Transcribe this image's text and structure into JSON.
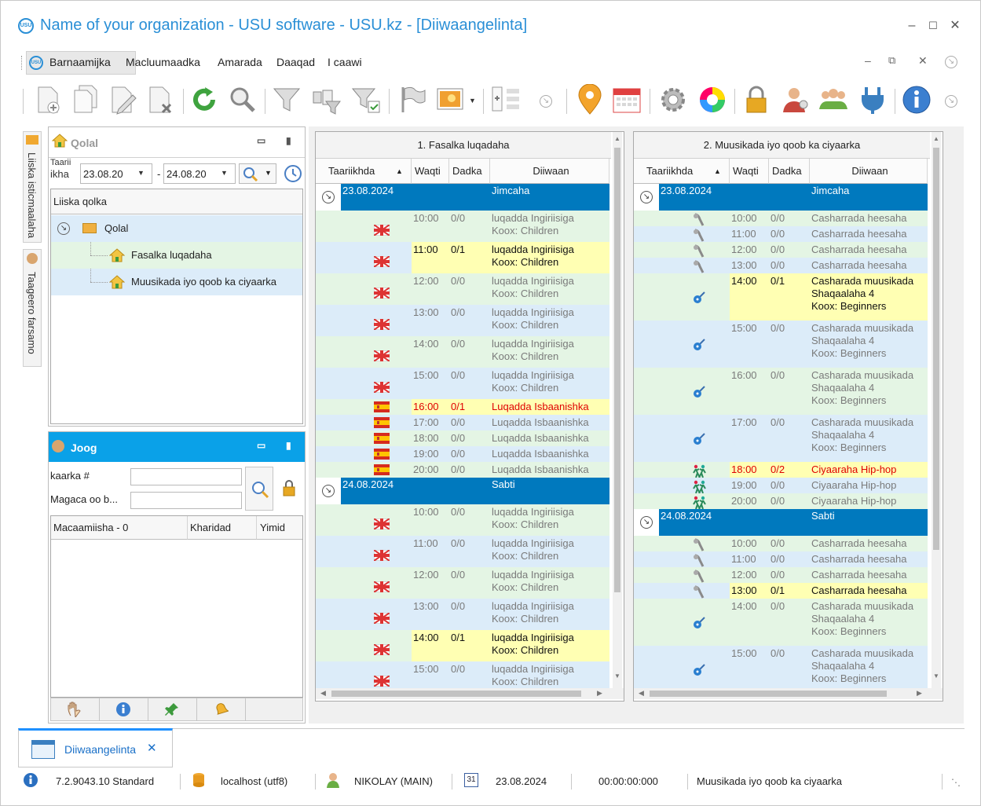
{
  "window": {
    "title": "Name of your organization - USU software - USU.kz - [Diiwaangelinta]",
    "logo_text": "USU"
  },
  "menu": {
    "items": [
      "Barnaamijka",
      "Macluumaadka",
      "Amarada",
      "Daaqad",
      "I caawi"
    ]
  },
  "toolbar": {
    "icons": [
      "add-icon",
      "copy-icon",
      "edit-icon",
      "delete-icon",
      "refresh-icon",
      "search-icon",
      "filter-icon",
      "filter-settings-icon",
      "filter-clear-icon",
      "flag-icon",
      "image-icon",
      "columns-icon",
      "location-pin-icon",
      "calendar-icon",
      "settings-gear-icon",
      "color-wheel-icon",
      "lock-icon",
      "user-admin-icon",
      "users-group-icon",
      "plug-icon",
      "info-icon"
    ]
  },
  "sidebar_tabs": [
    "Liiska isticmaalaha",
    "Taageero farsamo"
  ],
  "folders_panel": {
    "title": "Qolal",
    "date_label_top": "Taarii",
    "date_label": "ikha",
    "date_from": "23.08.20",
    "date_to": "24.08.20",
    "list_header": "Liiska qolka",
    "tree": [
      {
        "label": "Qolal",
        "level": 0
      },
      {
        "label": "Fasalka luqadaha",
        "level": 1
      },
      {
        "label": "Muusikada iyo qoob ka ciyaarka",
        "level": 1
      }
    ]
  },
  "booking_panel": {
    "title": "Joog",
    "card_label": "kaarka #",
    "name_label": "Magaca oo b...",
    "col_client": "Macaamiisha - 0",
    "col_expense": "Kharidad",
    "col_came": "Yimid"
  },
  "grid1": {
    "title": "1. Fasalka luqadaha",
    "columns": [
      "Taariikhda",
      "Waqti",
      "Dadka",
      "Diiwaan"
    ],
    "rows": [
      {
        "kind": "date",
        "date": "23.08.2024",
        "day": "Jimcaha"
      },
      {
        "kind": "row",
        "icon": "uk-flag-icon",
        "time": "10:00",
        "people": "0/0",
        "lines": [
          "luqadda Ingiriisiga",
          "Koox: Children"
        ],
        "bg": "green"
      },
      {
        "kind": "row",
        "icon": "uk-flag-icon",
        "time": "11:00",
        "people": "0/1",
        "lines": [
          "luqadda Ingiriisiga",
          "Koox: Children"
        ],
        "bg": "blue",
        "hl": true
      },
      {
        "kind": "row",
        "icon": "uk-flag-icon",
        "time": "12:00",
        "people": "0/0",
        "lines": [
          "luqadda Ingiriisiga",
          "Koox: Children"
        ],
        "bg": "green"
      },
      {
        "kind": "row",
        "icon": "uk-flag-icon",
        "time": "13:00",
        "people": "0/0",
        "lines": [
          "luqadda Ingiriisiga",
          "Koox: Children"
        ],
        "bg": "blue"
      },
      {
        "kind": "row",
        "icon": "uk-flag-icon",
        "time": "14:00",
        "people": "0/0",
        "lines": [
          "luqadda Ingiriisiga",
          "Koox: Children"
        ],
        "bg": "green"
      },
      {
        "kind": "row",
        "icon": "uk-flag-icon",
        "time": "15:00",
        "people": "0/0",
        "lines": [
          "luqadda Ingiriisiga",
          "Koox: Children"
        ],
        "bg": "blue"
      },
      {
        "kind": "row",
        "icon": "spain-flag-icon",
        "time": "16:00",
        "people": "0/1",
        "lines": [
          "Luqadda Isbaanishka"
        ],
        "bg": "green",
        "hl": true,
        "red": true
      },
      {
        "kind": "row",
        "icon": "spain-flag-icon",
        "time": "17:00",
        "people": "0/0",
        "lines": [
          "Luqadda Isbaanishka"
        ],
        "bg": "blue"
      },
      {
        "kind": "row",
        "icon": "spain-flag-icon",
        "time": "18:00",
        "people": "0/0",
        "lines": [
          "Luqadda Isbaanishka"
        ],
        "bg": "green"
      },
      {
        "kind": "row",
        "icon": "spain-flag-icon",
        "time": "19:00",
        "people": "0/0",
        "lines": [
          "Luqadda Isbaanishka"
        ],
        "bg": "blue"
      },
      {
        "kind": "row",
        "icon": "spain-flag-icon",
        "time": "20:00",
        "people": "0/0",
        "lines": [
          "Luqadda Isbaanishka"
        ],
        "bg": "green"
      },
      {
        "kind": "date",
        "date": "24.08.2024",
        "day": "Sabti"
      },
      {
        "kind": "row",
        "icon": "uk-flag-icon",
        "time": "10:00",
        "people": "0/0",
        "lines": [
          "luqadda Ingiriisiga",
          "Koox: Children"
        ],
        "bg": "green"
      },
      {
        "kind": "row",
        "icon": "uk-flag-icon",
        "time": "11:00",
        "people": "0/0",
        "lines": [
          "luqadda Ingiriisiga",
          "Koox: Children"
        ],
        "bg": "blue"
      },
      {
        "kind": "row",
        "icon": "uk-flag-icon",
        "time": "12:00",
        "people": "0/0",
        "lines": [
          "luqadda Ingiriisiga",
          "Koox: Children"
        ],
        "bg": "green"
      },
      {
        "kind": "row",
        "icon": "uk-flag-icon",
        "time": "13:00",
        "people": "0/0",
        "lines": [
          "luqadda Ingiriisiga",
          "Koox: Children"
        ],
        "bg": "blue"
      },
      {
        "kind": "row",
        "icon": "uk-flag-icon",
        "time": "14:00",
        "people": "0/1",
        "lines": [
          "luqadda Ingiriisiga",
          "Koox: Children"
        ],
        "bg": "green",
        "hl": true
      },
      {
        "kind": "row",
        "icon": "uk-flag-icon",
        "time": "15:00",
        "people": "0/0",
        "lines": [
          "luqadda Ingiriisiga",
          "Koox: Children"
        ],
        "bg": "blue"
      }
    ]
  },
  "grid2": {
    "title": "2. Muusikada iyo qoob ka ciyaarka",
    "columns": [
      "Taariikhda",
      "Waqti",
      "Dadka",
      "Diiwaan"
    ],
    "rows": [
      {
        "kind": "date",
        "date": "23.08.2024",
        "day": "Jimcaha"
      },
      {
        "kind": "row",
        "icon": "microphone-icon",
        "time": "10:00",
        "people": "0/0",
        "lines": [
          "Casharrada heesaha"
        ],
        "bg": "green"
      },
      {
        "kind": "row",
        "icon": "microphone-icon",
        "time": "11:00",
        "people": "0/0",
        "lines": [
          "Casharrada heesaha"
        ],
        "bg": "blue"
      },
      {
        "kind": "row",
        "icon": "microphone-icon",
        "time": "12:00",
        "people": "0/0",
        "lines": [
          "Casharrada heesaha"
        ],
        "bg": "green"
      },
      {
        "kind": "row",
        "icon": "microphone-icon",
        "time": "13:00",
        "people": "0/0",
        "lines": [
          "Casharrada heesaha"
        ],
        "bg": "blue"
      },
      {
        "kind": "row",
        "icon": "guitar-icon",
        "time": "14:00",
        "people": "0/1",
        "lines": [
          "Casharada muusikada",
          "Shaqaalaha 4",
          "Koox: Beginners"
        ],
        "bg": "green",
        "hl": true
      },
      {
        "kind": "row",
        "icon": "guitar-icon",
        "time": "15:00",
        "people": "0/0",
        "lines": [
          "Casharada muusikada",
          "Shaqaalaha 4",
          "Koox: Beginners"
        ],
        "bg": "blue"
      },
      {
        "kind": "row",
        "icon": "guitar-icon",
        "time": "16:00",
        "people": "0/0",
        "lines": [
          "Casharada muusikada",
          "Shaqaalaha 4",
          "Koox: Beginners"
        ],
        "bg": "green"
      },
      {
        "kind": "row",
        "icon": "guitar-icon",
        "time": "17:00",
        "people": "0/0",
        "lines": [
          "Casharada muusikada",
          "Shaqaalaha 4",
          "Koox: Beginners"
        ],
        "bg": "blue"
      },
      {
        "kind": "row",
        "icon": "dancers-icon",
        "time": "18:00",
        "people": "0/2",
        "lines": [
          "Ciyaaraha Hip-hop"
        ],
        "bg": "green",
        "hl": true,
        "red": true
      },
      {
        "kind": "row",
        "icon": "dancers-icon",
        "time": "19:00",
        "people": "0/0",
        "lines": [
          "Ciyaaraha Hip-hop"
        ],
        "bg": "blue"
      },
      {
        "kind": "row",
        "icon": "dancers-icon",
        "time": "20:00",
        "people": "0/0",
        "lines": [
          "Ciyaaraha Hip-hop"
        ],
        "bg": "green"
      },
      {
        "kind": "date",
        "date": "24.08.2024",
        "day": "Sabti"
      },
      {
        "kind": "row",
        "icon": "microphone-icon",
        "time": "10:00",
        "people": "0/0",
        "lines": [
          "Casharrada heesaha"
        ],
        "bg": "green"
      },
      {
        "kind": "row",
        "icon": "microphone-icon",
        "time": "11:00",
        "people": "0/0",
        "lines": [
          "Casharrada heesaha"
        ],
        "bg": "blue"
      },
      {
        "kind": "row",
        "icon": "microphone-icon",
        "time": "12:00",
        "people": "0/0",
        "lines": [
          "Casharrada heesaha"
        ],
        "bg": "green"
      },
      {
        "kind": "row",
        "icon": "microphone-icon",
        "time": "13:00",
        "people": "0/1",
        "lines": [
          "Casharrada heesaha"
        ],
        "bg": "blue",
        "hl": true
      },
      {
        "kind": "row",
        "icon": "guitar-icon",
        "time": "14:00",
        "people": "0/0",
        "lines": [
          "Casharada muusikada",
          "Shaqaalaha 4",
          "Koox: Beginners"
        ],
        "bg": "green"
      },
      {
        "kind": "row",
        "icon": "guitar-icon",
        "time": "15:00",
        "people": "0/0",
        "lines": [
          "Casharada muusikada",
          "Shaqaalaha 4",
          "Koox: Beginners"
        ],
        "bg": "blue"
      }
    ]
  },
  "doc_tab": {
    "label": "Diiwaangelinta"
  },
  "status": {
    "version": "7.2.9043.10 Standard",
    "db": "localhost (utf8)",
    "user": "NIKOLAY (MAIN)",
    "date": "23.08.2024",
    "timer": "00:00:00:000",
    "room": "Muusikada iyo qoob ka ciyaarka",
    "calendar_day": "31"
  },
  "colors": {
    "accent": "#2a8fd6",
    "date_row": "#0079be",
    "highlight": "#ffffb3",
    "row_green": "#e4f5e4",
    "row_blue": "#dcecf9",
    "alert_red": "#e00000",
    "panel_header": "#0aa1e8"
  }
}
